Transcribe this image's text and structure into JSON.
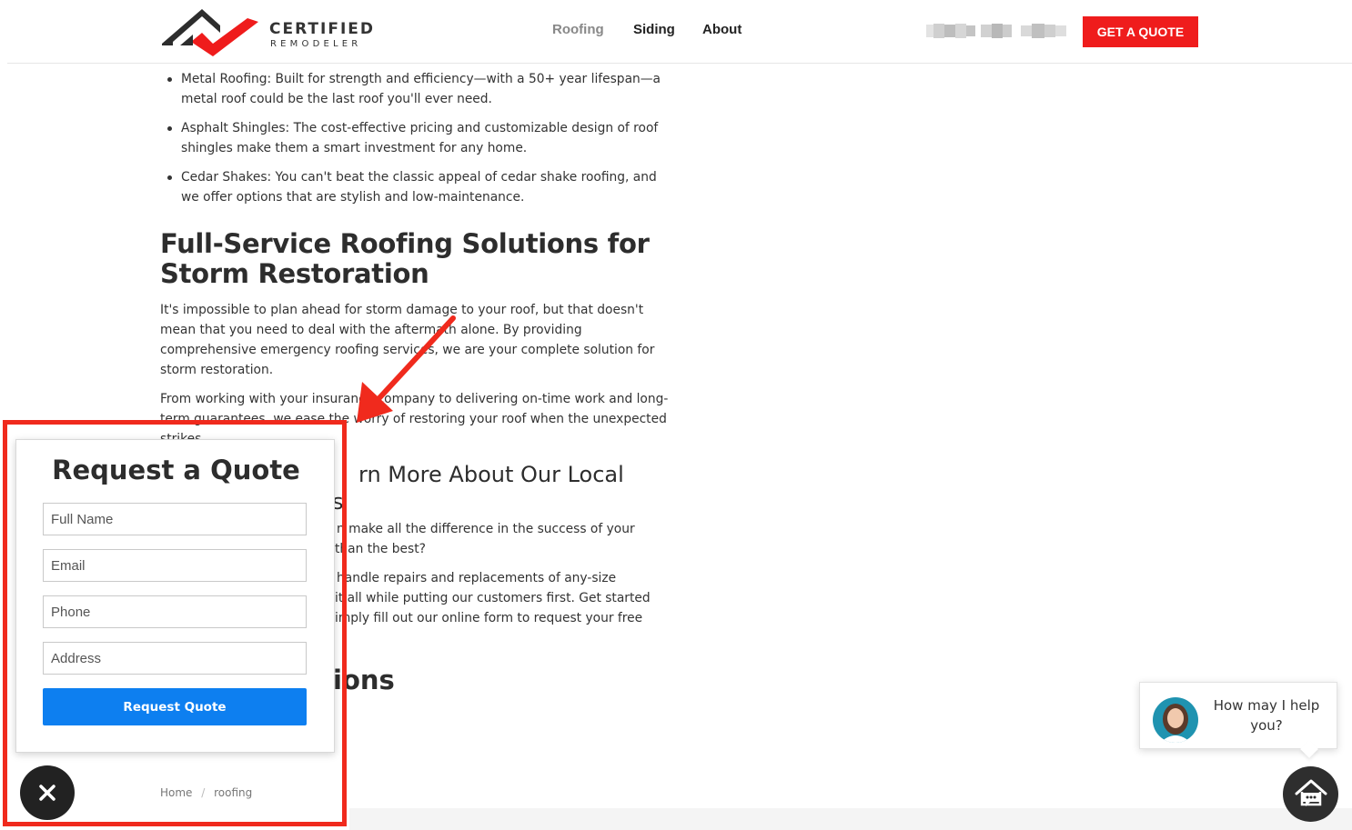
{
  "header": {
    "logo_line1": "CERTIFIED",
    "logo_line2": "REMODELER",
    "nav": [
      {
        "label": "Roofing"
      },
      {
        "label": "Siding"
      },
      {
        "label": "About"
      }
    ],
    "cta_label": "GET A QUOTE"
  },
  "content": {
    "bullets": [
      "Metal Roofing: Built for strength and efficiency—with a 50+ year lifespan—a metal roof could be the last roof you'll ever need.",
      "Asphalt Shingles: The cost-effective pricing and customizable design of roof shingles make them a smart investment for any home.",
      "Cedar Shakes: You can't beat the classic appeal of cedar shake roofing, and we offer options that are stylish and low-maintenance."
    ],
    "heading1": "Full-Service Roofing Solutions for Storm Restoration",
    "para1": "It's impossible to plan ahead for storm damage to your roof, but that doesn't mean that you need to deal with the aftermath alone. By providing comprehensive emergency roofing services, we are your complete solution for storm restoration.",
    "para2": "From working with your insurance company to delivering on-time work and long-term guarantees, we ease the worry of restoring your roof when the unexpected strikes.",
    "heading2_visible": "rn More About Our Local",
    "heading2_line2": "s",
    "frag1": "n make all the difference in the success of your",
    "frag2": "than the best?",
    "frag3": "handle repairs and replacements of any-size",
    "frag4": "it all while putting our customers first. Get started",
    "frag5": "imply fill out our online form to request your free",
    "heading3_visible": "ions"
  },
  "breadcrumb": {
    "home": "Home",
    "sep": "/",
    "current": "roofing"
  },
  "popup": {
    "title": "Request a Quote",
    "fields": [
      {
        "placeholder": "Full Name"
      },
      {
        "placeholder": "Email"
      },
      {
        "placeholder": "Phone"
      },
      {
        "placeholder": "Address"
      }
    ],
    "submit_label": "Request Quote",
    "close_icon": "close-icon"
  },
  "chat": {
    "message": "How may I help you?",
    "launcher_icon": "chat-house-icon"
  },
  "colors": {
    "brand_red": "#ef1c1c",
    "button_blue": "#0d7ff0",
    "annotation_red": "#f02a1d",
    "dark": "#2d2d2d"
  }
}
